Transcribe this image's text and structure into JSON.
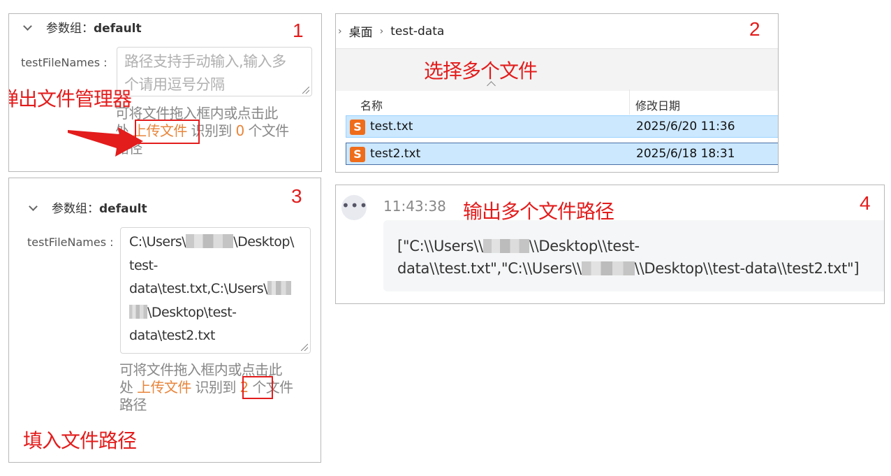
{
  "panel1": {
    "step": "1",
    "group_label": "参数组：",
    "group_name": "default",
    "field_label": "testFileNames :",
    "placeholder_line1": "路径支持手动输入,输入多",
    "placeholder_line2": "个请用逗号分隔",
    "hint_line1": "可将文件拖入框内或点击此",
    "hint_line2_prefix": "处 ",
    "upload_link": "上传文件",
    "recognized_prefix": " 识别到 ",
    "count": "0",
    "recognized_suffix": " 个文件",
    "hint_line3": "路径",
    "annotation": "弹出文件管理器"
  },
  "panel2": {
    "step": "2",
    "breadcrumb": [
      "桌面",
      "test-data"
    ],
    "annotation": "选择多个文件",
    "columns": [
      "名称",
      "修改日期"
    ],
    "files": [
      {
        "name": "test.txt",
        "date": "2025/6/20 11:36"
      },
      {
        "name": "test2.txt",
        "date": "2025/6/18 18:31"
      }
    ]
  },
  "panel3": {
    "step": "3",
    "group_label": "参数组：",
    "group_name": "default",
    "field_label": "testFileNames :",
    "value_lines": [
      "C:\\Users\\",
      "\\Desktop\\",
      "test-",
      "data\\test.txt,C:\\Users\\",
      "\\Desktop\\test-",
      "data\\test2.txt"
    ],
    "hint_line1": "可将文件拖入框内或点击此",
    "hint_line2_prefix": "处 ",
    "upload_link": "上传文件",
    "recognized_prefix": " 识别到 ",
    "count": "2",
    "recognized_suffix": " 个文件",
    "hint_line3": "路径",
    "annotation": "填入文件路径"
  },
  "panel4": {
    "step": "4",
    "time": "11:43:38",
    "annotation": "输出多个文件路径",
    "line1_a": "[\"C:\\\\Users\\\\",
    "line1_b": "\\\\Desktop\\\\test-",
    "line2_a": "data\\\\test.txt\",\"C:\\\\Users\\\\",
    "line2_b": "\\\\Desktop\\\\test-data\\\\test2.txt\"]"
  },
  "colors": {
    "annotation_red": "#e31c1c",
    "link_orange": "#e8853a",
    "selection_blue": "#cce8ff",
    "sublime_icon": "#ef6c1a"
  },
  "icons": [
    "chevron-down-icon",
    "sort-up-icon",
    "sublime-file-icon",
    "more-dots-icon",
    "resize-grip-icon",
    "red-arrow-icon"
  ]
}
